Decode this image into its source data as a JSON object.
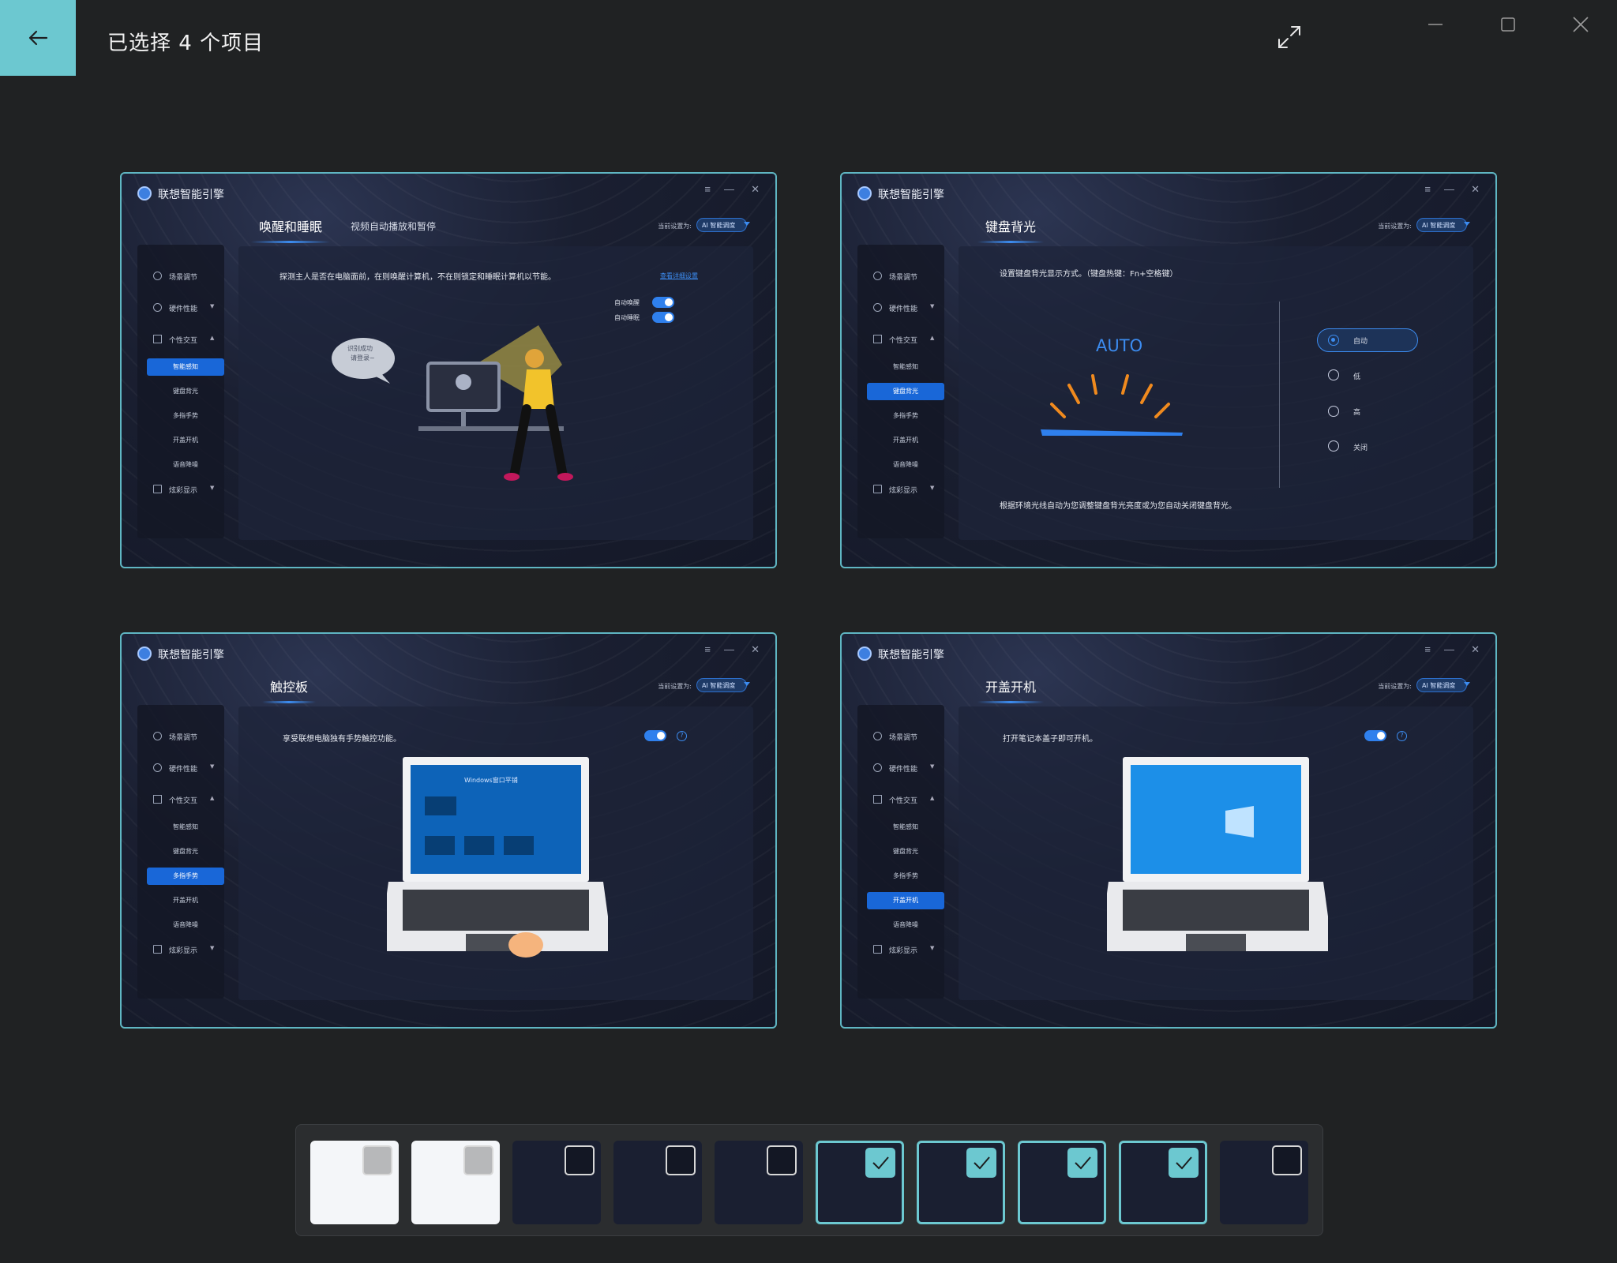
{
  "header": {
    "title": "已选择 4 个项目",
    "back_icon": "arrow-left-icon",
    "expand_icon": "expand-icon"
  },
  "window": {
    "minimize": "minimize-icon",
    "maximize": "maximize-icon",
    "close": "close-icon"
  },
  "colors": {
    "accent": "#6cc8d0",
    "background": "#202223",
    "app_blue": "#1967d8"
  },
  "app": {
    "name": "联想智能引擎",
    "mode_label": "当前设置为:",
    "mode_value": "AI 智能调度",
    "sidebar": {
      "scene": "场景调节",
      "hardware": "硬件性能",
      "interaction": "个性交互",
      "display": "炫彩显示",
      "sub": [
        "智能感知",
        "键盘背光",
        "多指手势",
        "开盖开机",
        "语音降噪"
      ]
    }
  },
  "cards": [
    {
      "heading": "唤醒和睡眠",
      "subtab": "视频自动播放和暂停",
      "description": "探测主人是否在电脑面前，在则唤醒计算机，不在则锁定和睡眠计算机以节能。",
      "link": "查看详细设置",
      "toggle_wake": "自动唤醒",
      "toggle_sleep": "自动睡眠",
      "bubble": [
        "识别成功",
        "请登录~"
      ],
      "active_sub": 0
    },
    {
      "heading": "键盘背光",
      "description": "设置键盘背光显示方式。（键盘热键：Fn+空格键）",
      "auto_text": "AUTO",
      "options": [
        "自动",
        "低",
        "高",
        "关闭"
      ],
      "footer": "根据环境光线自动为您调整键盘背光亮度或为您自动关闭键盘背光。",
      "active_sub": 1
    },
    {
      "heading": "触控板",
      "description": "享受联想电脑独有手势触控功能。",
      "screen_label": "Windows窗口平铺",
      "active_sub": 2
    },
    {
      "heading": "开盖开机",
      "description": "打开笔记本盖子即可开机。",
      "active_sub": 3
    }
  ],
  "filmstrip": {
    "items": [
      {
        "selected": false,
        "theme": "light"
      },
      {
        "selected": false,
        "theme": "light"
      },
      {
        "selected": false,
        "theme": "dark"
      },
      {
        "selected": false,
        "theme": "dark"
      },
      {
        "selected": false,
        "theme": "dark"
      },
      {
        "selected": true,
        "theme": "dark"
      },
      {
        "selected": true,
        "theme": "dark"
      },
      {
        "selected": true,
        "theme": "dark"
      },
      {
        "selected": true,
        "theme": "dark"
      },
      {
        "selected": false,
        "theme": "dark"
      }
    ],
    "check_icon": "checkmark-icon"
  }
}
